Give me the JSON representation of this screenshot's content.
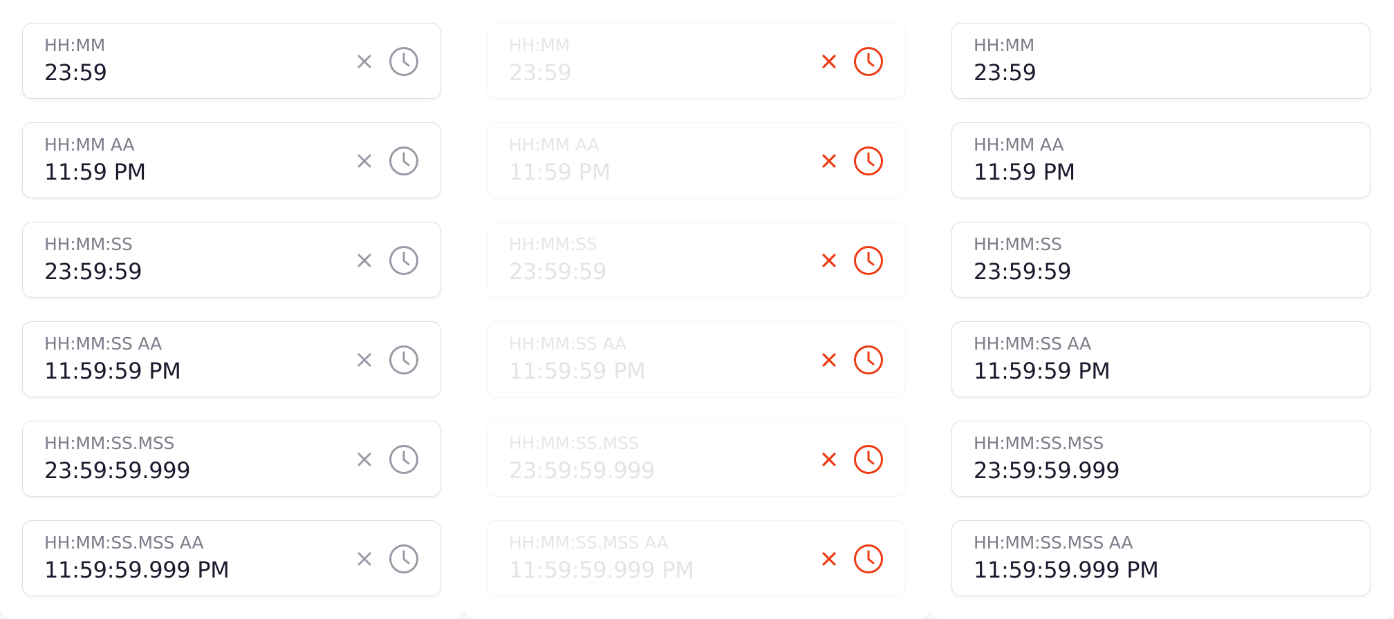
{
  "colors": {
    "icon_default": "#9a9aa6",
    "icon_accent": "#ee3a12",
    "label": "#7c7c8a",
    "value": "#1a1a2e",
    "disabled_text": "#e4e4e8"
  },
  "icons": {
    "clear": "close-icon",
    "picker": "clock-icon"
  },
  "columns": [
    {
      "variant": "default",
      "fields": [
        {
          "format": "HH:MM",
          "value": "23:59"
        },
        {
          "format": "HH:MM AA",
          "value": "11:59 PM"
        },
        {
          "format": "HH:MM:SS",
          "value": "23:59:59"
        },
        {
          "format": "HH:MM:SS AA",
          "value": "11:59:59 PM"
        },
        {
          "format": "HH:MM:SS.MSS",
          "value": "23:59:59.999"
        },
        {
          "format": "HH:MM:SS.MSS AA",
          "value": "11:59:59.999 PM"
        }
      ]
    },
    {
      "variant": "disabled",
      "fields": [
        {
          "format": "HH:MM",
          "value": "23:59"
        },
        {
          "format": "HH:MM AA",
          "value": "11:59 PM"
        },
        {
          "format": "HH:MM:SS",
          "value": "23:59:59"
        },
        {
          "format": "HH:MM:SS AA",
          "value": "11:59:59 PM"
        },
        {
          "format": "HH:MM:SS.MSS",
          "value": "23:59:59.999"
        },
        {
          "format": "HH:MM:SS.MSS AA",
          "value": "11:59:59.999 PM"
        }
      ]
    },
    {
      "variant": "no-icons",
      "fields": [
        {
          "format": "HH:MM",
          "value": "23:59"
        },
        {
          "format": "HH:MM AA",
          "value": "11:59 PM"
        },
        {
          "format": "HH:MM:SS",
          "value": "23:59:59"
        },
        {
          "format": "HH:MM:SS AA",
          "value": "11:59:59 PM"
        },
        {
          "format": "HH:MM:SS.MSS",
          "value": "23:59:59.999"
        },
        {
          "format": "HH:MM:SS.MSS AA",
          "value": "11:59:59.999 PM"
        }
      ]
    }
  ]
}
